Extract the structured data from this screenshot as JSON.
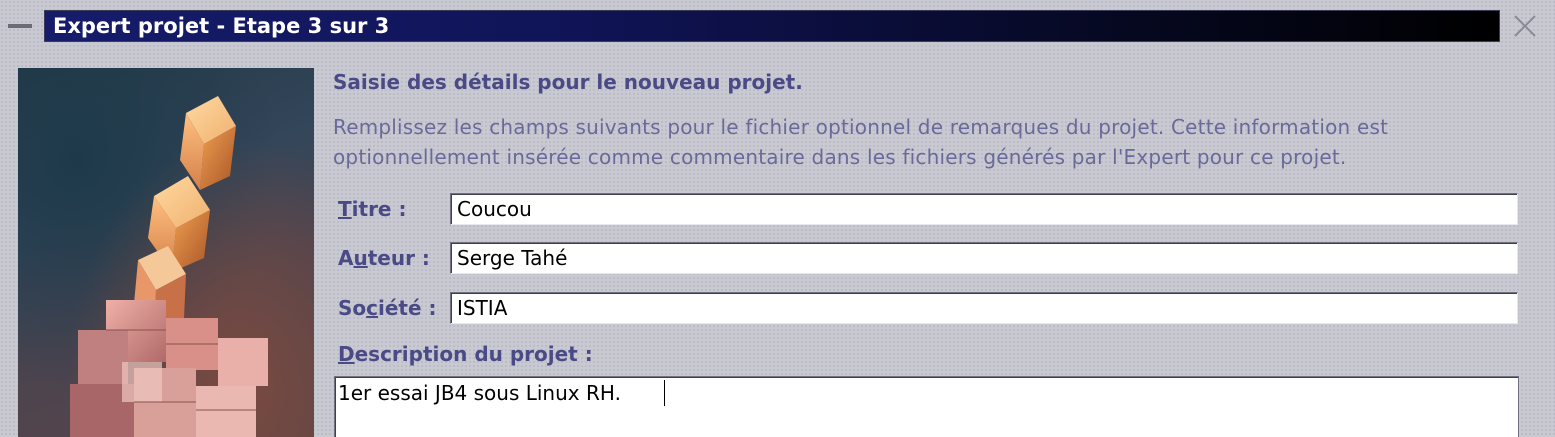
{
  "window": {
    "title": "Expert projet - Etape 3 sur 3"
  },
  "content": {
    "heading": "Saisie des détails pour le nouveau projet.",
    "description_line1": "Remplissez les champs suivants pour le fichier optionnel de remarques du projet. Cette information est",
    "description_line2": "optionnellement insérée comme commentaire dans les fichiers générés par l'Expert pour ce projet."
  },
  "fields": {
    "titre": {
      "label_mnemonic": "T",
      "label_rest": "itre :",
      "value": "Coucou"
    },
    "auteur": {
      "label_pre": "A",
      "label_mnemonic": "u",
      "label_rest": "teur :",
      "value": "Serge Tahé"
    },
    "societe": {
      "label_pre": "So",
      "label_mnemonic": "c",
      "label_rest": "iété :",
      "value": "ISTIA"
    },
    "description": {
      "label_mnemonic": "D",
      "label_rest": "escription du projet :",
      "value": "1er essai JB4 sous Linux RH."
    }
  },
  "icons": {
    "window_menu": "minimize-bar-icon",
    "close": "close-icon"
  },
  "colors": {
    "title_bar_start": "#161c6a",
    "title_bar_end": "#000000",
    "label_text": "#4a4a86",
    "description_text": "#6a6a9a",
    "background": "#c9c9d2"
  }
}
